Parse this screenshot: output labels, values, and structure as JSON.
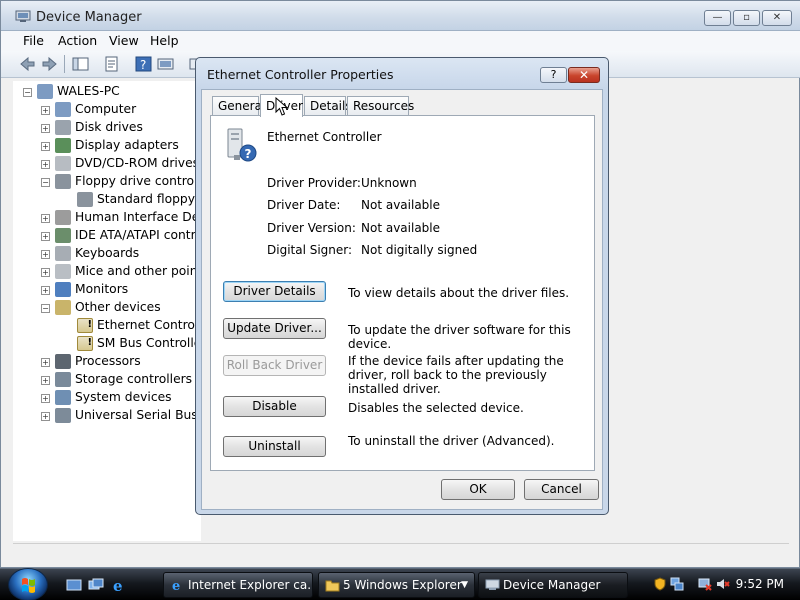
{
  "window": {
    "title": "Device Manager",
    "menu": [
      "File",
      "Action",
      "View",
      "Help"
    ]
  },
  "tree": [
    {
      "label": "WALES-PC",
      "level": 0,
      "expander": "−",
      "icon": "computer-icon"
    },
    {
      "label": "Computer",
      "level": 1,
      "expander": "+",
      "icon": "computer-icon"
    },
    {
      "label": "Disk drives",
      "level": 1,
      "expander": "+",
      "icon": "disk-drive-icon"
    },
    {
      "label": "Display adapters",
      "level": 1,
      "expander": "+",
      "icon": "display-adapter-icon"
    },
    {
      "label": "DVD/CD-ROM drives",
      "level": 1,
      "expander": "+",
      "icon": "dvd-drive-icon"
    },
    {
      "label": "Floppy drive controllers",
      "level": 1,
      "expander": "−",
      "icon": "floppy-controller-icon"
    },
    {
      "label": "Standard floppy disk controller",
      "level": 2,
      "expander": "",
      "icon": "floppy-controller-icon"
    },
    {
      "label": "Human Interface Devices",
      "level": 1,
      "expander": "+",
      "icon": "hid-icon"
    },
    {
      "label": "IDE ATA/ATAPI controllers",
      "level": 1,
      "expander": "+",
      "icon": "ide-controller-icon"
    },
    {
      "label": "Keyboards",
      "level": 1,
      "expander": "+",
      "icon": "keyboard-icon"
    },
    {
      "label": "Mice and other pointing devices",
      "level": 1,
      "expander": "+",
      "icon": "mouse-icon"
    },
    {
      "label": "Monitors",
      "level": 1,
      "expander": "+",
      "icon": "monitor-icon"
    },
    {
      "label": "Other devices",
      "level": 1,
      "expander": "−",
      "icon": "unknown-device-icon"
    },
    {
      "label": "Ethernet Controller",
      "level": 2,
      "expander": "",
      "icon": "warning-device-icon"
    },
    {
      "label": "SM Bus Controller",
      "level": 2,
      "expander": "",
      "icon": "warning-device-icon"
    },
    {
      "label": "Processors",
      "level": 1,
      "expander": "+",
      "icon": "processor-icon"
    },
    {
      "label": "Storage controllers",
      "level": 1,
      "expander": "+",
      "icon": "storage-controller-icon"
    },
    {
      "label": "System devices",
      "level": 1,
      "expander": "+",
      "icon": "system-device-icon"
    },
    {
      "label": "Universal Serial Bus controllers",
      "level": 1,
      "expander": "+",
      "icon": "usb-icon"
    }
  ],
  "dialog": {
    "title": "Ethernet Controller Properties",
    "help_label": "?",
    "close_label": "✕",
    "tabs": [
      "General",
      "Driver",
      "Details",
      "Resources"
    ],
    "active_tab": "Driver",
    "device_name": "Ethernet Controller",
    "properties": [
      {
        "label": "Driver Provider:",
        "value": "Unknown"
      },
      {
        "label": "Driver Date:",
        "value": "Not available"
      },
      {
        "label": "Driver Version:",
        "value": "Not available"
      },
      {
        "label": "Digital Signer:",
        "value": "Not digitally signed"
      }
    ],
    "actions": [
      {
        "label": "Driver Details",
        "desc": "To view details about the driver files.",
        "state": "default"
      },
      {
        "label": "Update Driver...",
        "desc": "To update the driver software for this device.",
        "state": "normal"
      },
      {
        "label": "Roll Back Driver",
        "desc": "If the device fails after updating the driver, roll back to the previously installed driver.",
        "state": "disabled"
      },
      {
        "label": "Disable",
        "desc": "Disables the selected device.",
        "state": "normal"
      },
      {
        "label": "Uninstall",
        "desc": "To uninstall the driver (Advanced).",
        "state": "normal"
      }
    ],
    "ok_label": "OK",
    "cancel_label": "Cancel"
  },
  "taskbar": {
    "buttons": [
      {
        "label": "Internet Explorer ca...",
        "icon": "ie-icon"
      },
      {
        "label": "5 Windows Explorer",
        "icon": "folder-icon"
      },
      {
        "label": "Device Manager",
        "icon": "device-manager-icon"
      }
    ],
    "clock": "9:52 PM"
  },
  "colors": {
    "accent": "#3c7fb1",
    "close_button": "#c9442c",
    "taskbar": "#15191f"
  }
}
